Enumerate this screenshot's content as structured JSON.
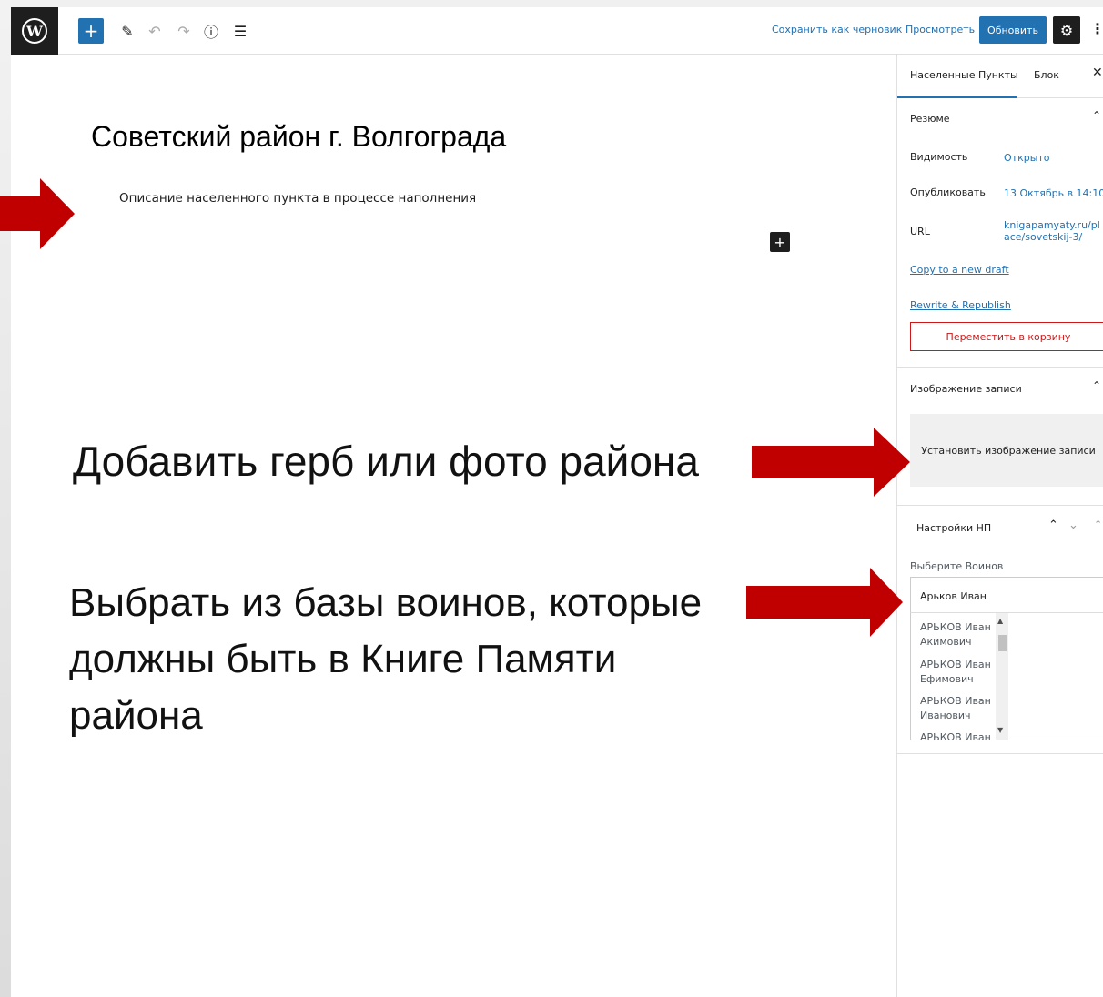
{
  "toolbar": {
    "logo": "W",
    "add_icon": "+",
    "pen_icon": "✎",
    "undo_icon": "↶",
    "redo_icon": "↷",
    "info_icon": "ⓘ",
    "list_icon": "☰",
    "save_draft": "Сохранить как черновик",
    "preview": "Просмотреть",
    "update": "Обновить",
    "settings_icon": "⚙",
    "more_icon": "⋮"
  },
  "editor": {
    "title": "Советский район г. Волгограда",
    "description": "Описание населенного пункта в процессе наполнения",
    "block_add_icon": "+"
  },
  "annotations": {
    "featured_hint": "Добавить герб или фото района",
    "warriors_hint": "Выбрать из базы воинов, которые должны быть в Книге Памяти района"
  },
  "sidebar": {
    "tabs": [
      "Населенные Пункты",
      "Блок"
    ],
    "close_icon": "✕",
    "summary": {
      "title": "Резюме",
      "visibility_label": "Видимость",
      "visibility_value": "Открыто",
      "publish_label": "Опубликовать",
      "publish_value": "13 Октябрь в 14:10",
      "url_label": "URL",
      "url_value": "knigapamyaty.ru/place/sovetskij-3/",
      "copy_draft": "Copy to a new draft",
      "rewrite": "Rewrite & Republish",
      "trash": "Переместить в корзину"
    },
    "featured": {
      "title": "Изображение записи",
      "set_button": "Установить изображение записи"
    },
    "np_settings": {
      "title": "Настройки НП",
      "warriors_label": "Выберите Воинов",
      "selected": "Арьков Иван",
      "options": [
        "АРЬКОВ Иван Акимович",
        "АРЬКОВ Иван Ефимович",
        "АРЬКОВ Иван Иванович",
        "АРЬКОВ Иван"
      ]
    }
  },
  "colors": {
    "accent": "#2271b1",
    "arrow": "#c00000",
    "danger": "#cc1818"
  }
}
